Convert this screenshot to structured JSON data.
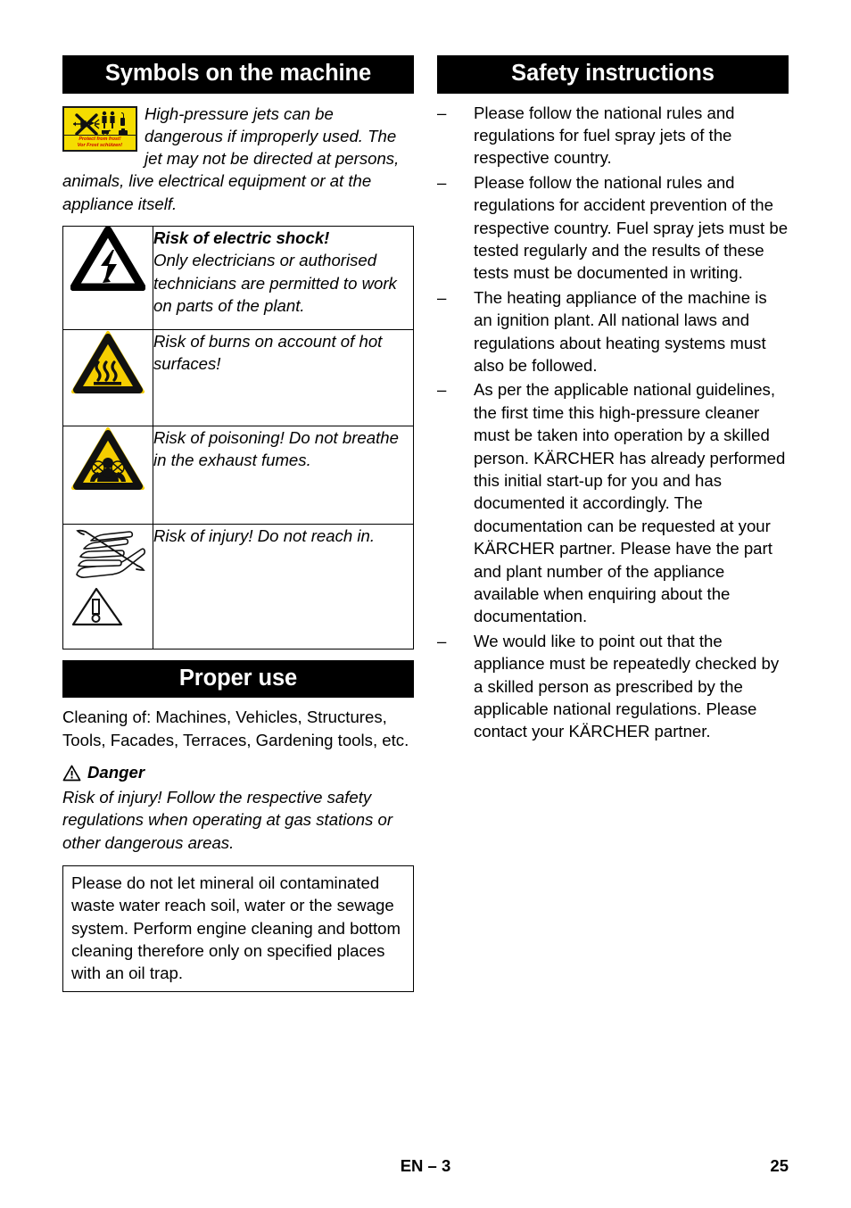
{
  "document": {
    "language_marker": "EN",
    "footer_center": "EN – 3",
    "footer_page": "25"
  },
  "left_column": {
    "section_title": "Symbols on the machine",
    "intro_paragraph": "High-pressure jets can be dangerous if improperly used. The jet may not be directed at persons, animals, live electrical equipment or at the appliance itself.",
    "sticker": {
      "name": "frost-protection-warning-label",
      "line1": "Protect from frost!",
      "line2": "Vor Frost schützen!",
      "background_color": "#F5DD00",
      "text_color": "#CC0000"
    },
    "symbols_table": {
      "rows": [
        {
          "icon": "electric-shock-triangle-icon",
          "icon_colors": {
            "fill": "#FFFFFF",
            "border": "#000000"
          },
          "heading": "Risk of electric shock!",
          "text": "Only electricians or authorised technicians are permitted to work on parts of the plant."
        },
        {
          "icon": "hot-surface-triangle-icon",
          "icon_colors": {
            "fill": "#F5CE00",
            "border": "#000000"
          },
          "heading": "",
          "text": "Risk of burns on account of hot surfaces!"
        },
        {
          "icon": "toxic-fumes-triangle-icon",
          "icon_colors": {
            "fill": "#F5CE00",
            "border": "#000000"
          },
          "heading": "",
          "text": "Risk of poisoning! Do not breathe in the exhaust fumes."
        },
        {
          "icon": "hand-crush-injury-icon",
          "icon_colors": {
            "fill": "#FFFFFF",
            "border": "#000000"
          },
          "heading": "",
          "text": "Risk of injury! Do not reach in."
        }
      ]
    },
    "proper_use": {
      "section_title": "Proper use",
      "paragraph": "Cleaning of: Machines, Vehicles, Structures, Tools, Facades, Terraces, Gardening tools, etc.",
      "danger": {
        "icon": "warning-triangle-icon",
        "label": "Danger",
        "text": "Risk of injury! Follow the respective safety regulations when operating at gas stations or other dangerous areas."
      },
      "note_box": "Please do not let mineral oil contaminated waste water reach soil, water or the sewage system. Perform engine cleaning and bottom cleaning therefore only on specified places with an oil trap."
    }
  },
  "right_column": {
    "section_title": "Safety instructions",
    "bullet_marker": "–",
    "bullets": [
      "Please follow the national rules and regulations for fuel spray jets of the respective country.",
      "Please follow the national rules and regulations for accident prevention of the respective country. Fuel spray jets must be tested regularly and the results of these tests must be documented in writing.",
      "The heating appliance of the machine is an ignition plant. All national laws and regulations about heating systems must also be followed.",
      "As per the applicable national guidelines, the first time this high-pressure cleaner must be taken into operation by a skilled person. KÄRCHER has already performed this initial start-up for you and has documented it accordingly. The documentation can be requested at your KÄRCHER partner. Please have the part and plant number of the appliance available when enquiring about the documentation.",
      "We would like to point out that the appliance must be repeatedly checked by a skilled person as prescribed by the applicable national regulations. Please contact your KÄRCHER partner."
    ]
  }
}
